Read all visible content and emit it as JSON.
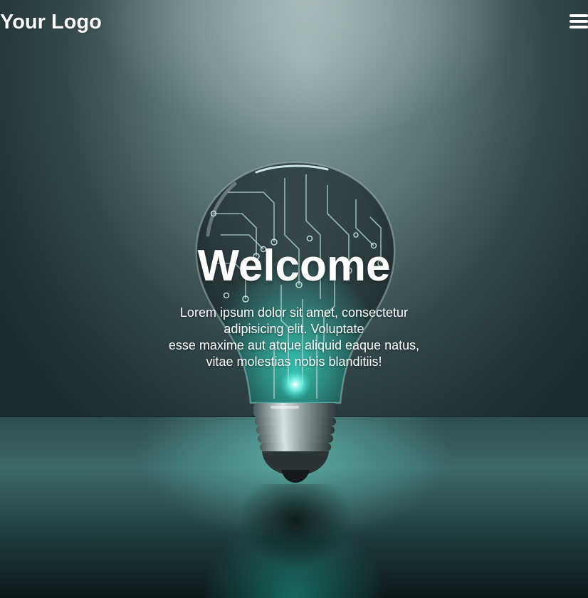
{
  "header": {
    "logo_text": "Your Logo",
    "menu_icon": "hamburger-menu-icon"
  },
  "hero": {
    "title": "Welcome",
    "description_lines": [
      "Lorem ipsum dolor sit amet, consectetur",
      "adipisicing elit. Voluptate",
      "esse maxime aut atque aliquid eaque natus,",
      "vitae molestias nobis blanditiis!"
    ],
    "background_image": "lightbulb-circuit-illustration"
  },
  "colors": {
    "text": "#ffffff",
    "accent_teal": "#2fd3bd",
    "background_dark": "#1b2a2e"
  }
}
